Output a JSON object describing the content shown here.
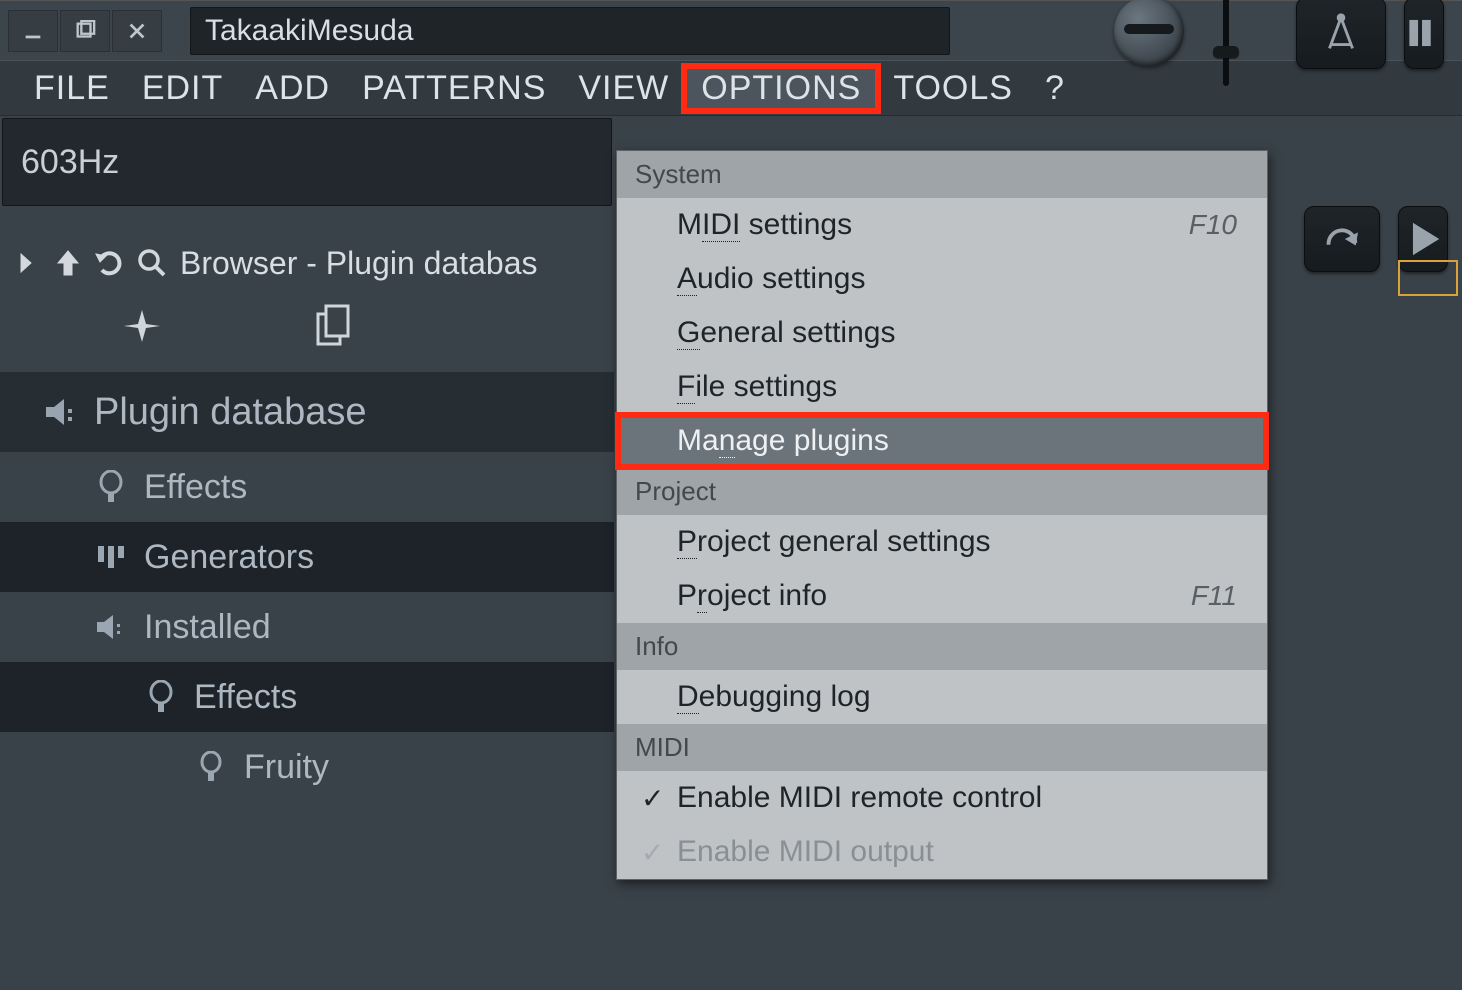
{
  "title": "TakaakiMesuda",
  "menu": {
    "file": "FILE",
    "edit": "EDIT",
    "add": "ADD",
    "patterns": "PATTERNS",
    "view": "VIEW",
    "options": "OPTIONS",
    "tools": "TOOLS",
    "help": "?"
  },
  "hint": "603Hz",
  "browser": {
    "title": "Browser - Plugin databas"
  },
  "tree": {
    "root": "Plugin database",
    "effects": "Effects",
    "generators": "Generators",
    "installed": "Installed",
    "installed_effects": "Effects",
    "fruity": "Fruity"
  },
  "options_menu": {
    "sections": {
      "system": "System",
      "project": "Project",
      "info": "Info",
      "midi": "MIDI"
    },
    "items": {
      "midi_settings": {
        "label_pre": "M",
        "label_ul": "IDI",
        "label_post": " settings",
        "shortcut": "F10"
      },
      "audio_settings": {
        "label_pre": "",
        "label_ul": "A",
        "label_post": "udio settings"
      },
      "general_settings": {
        "label_pre": "",
        "label_ul": "G",
        "label_post": "eneral settings"
      },
      "file_settings": {
        "label_pre": "",
        "label_ul": "F",
        "label_post": "ile settings"
      },
      "manage_plugins": {
        "label_pre": "Ma",
        "label_ul": "n",
        "label_post": "age plugins"
      },
      "project_general": {
        "label_pre": "",
        "label_ul": "P",
        "label_post": "roject general settings"
      },
      "project_info": {
        "label_pre": "P",
        "label_ul": "r",
        "label_post": "oject info",
        "shortcut": "F11"
      },
      "debugging_log": {
        "label_pre": "",
        "label_ul": "D",
        "label_post": "ebugging log"
      },
      "enable_midi_remote": {
        "label": "Enable MIDI remote control",
        "checked": true
      },
      "enable_midi_output": {
        "label": "Enable MIDI output",
        "checked": true
      }
    }
  }
}
